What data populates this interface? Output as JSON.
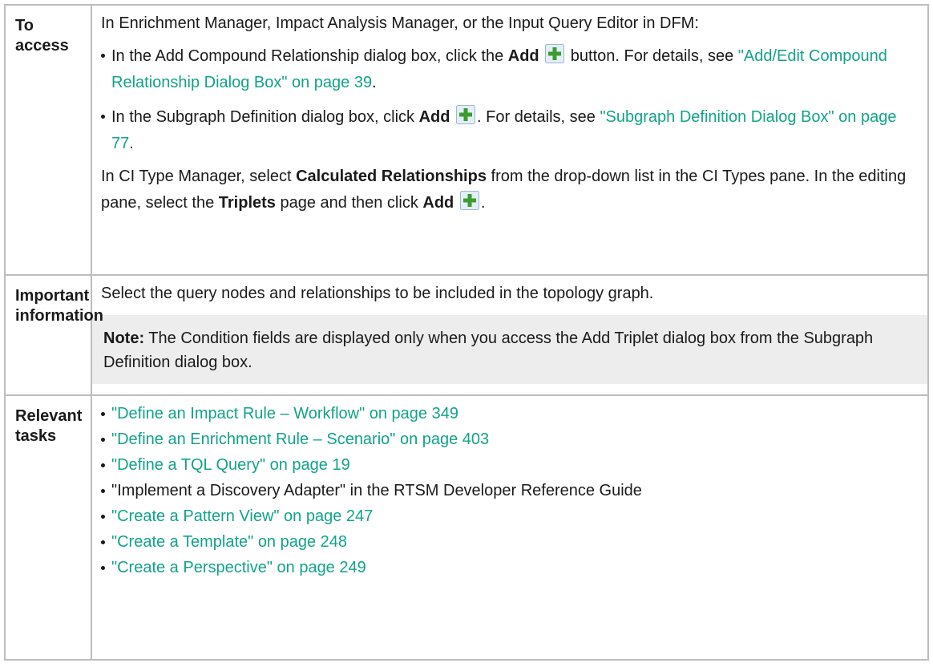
{
  "rows": {
    "access": {
      "label": "To access",
      "intro": "In Enrichment Manager, Impact Analysis Manager, or the Input Query Editor in DFM:",
      "bullet1": {
        "t1": "In the Add Compound Relationship dialog box, click the ",
        "bold": "Add",
        "t2": " button. For details, see ",
        "link": "\"Add/Edit Compound Relationship Dialog Box\" on page 39",
        "t3": "."
      },
      "bullet2": {
        "t1": "In the Subgraph Definition dialog box, click ",
        "bold": "Add",
        "t2": ". For details, see ",
        "link": "\"Subgraph Definition Dialog Box\" on page 77",
        "t3": "."
      },
      "para": {
        "t1": "In CI Type Manager, select ",
        "bold1": "Calculated Relationships",
        "t2": " from the drop-down list in the CI Types pane. In the editing pane, select the ",
        "bold2": "Triplets",
        "t3": " page and then click ",
        "bold3": "Add",
        "t4": "."
      }
    },
    "important": {
      "label": "Important information",
      "text": "Select the query nodes and relationships to be included in the topology graph.",
      "note_label": "Note:",
      "note_text": " The Condition fields are displayed only when you access the Add Triplet dialog box from the Subgraph Definition dialog box."
    },
    "tasks": {
      "label": "Relevant tasks",
      "items": [
        {
          "text": "\"Define an Impact Rule – Workflow\" on page 349",
          "is_link": true
        },
        {
          "text": "\"Define an Enrichment Rule – Scenario\" on page 403",
          "is_link": true
        },
        {
          "text": "\"Define a TQL Query\" on page 19",
          "is_link": true
        },
        {
          "text": "\"Implement a Discovery Adapter\" in the RTSM Developer Reference Guide",
          "is_link": false
        },
        {
          "text": "\"Create a Pattern View\" on page 247",
          "is_link": true
        },
        {
          "text": "\"Create a Template\" on page 248",
          "is_link": true
        },
        {
          "text": "\"Create a Perspective\" on page 249",
          "is_link": true
        }
      ]
    }
  },
  "icons": {
    "add": "add-plus-icon"
  },
  "colors": {
    "link": "#11a38a",
    "border": "#bdbdbd",
    "note_bg": "#ededed",
    "icon_plus": "#3c9c2e"
  }
}
